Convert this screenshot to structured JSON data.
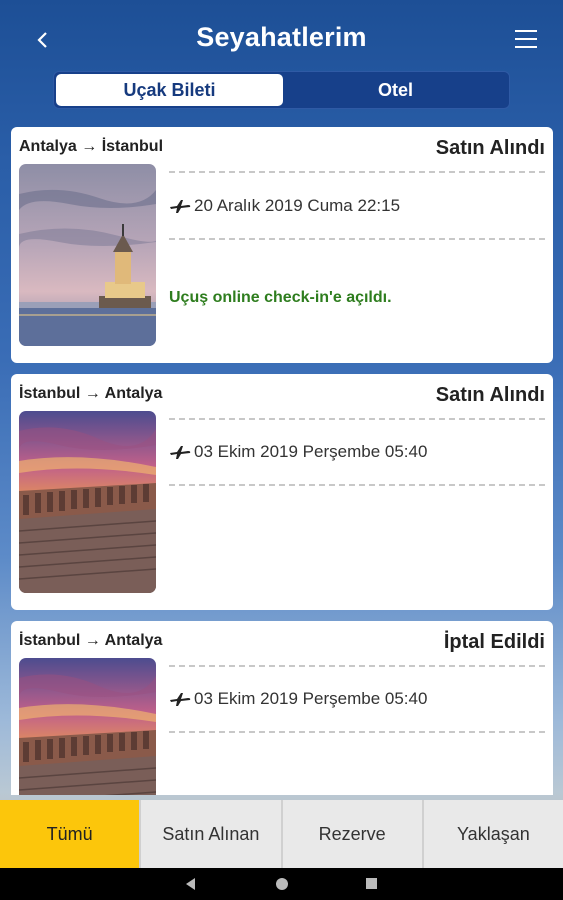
{
  "header": {
    "title": "Seyahatlerim",
    "back_icon": "chevron-left-icon",
    "menu_icon": "hamburger-menu-icon"
  },
  "tabs": [
    {
      "label": "Uçak Bileti",
      "active": true
    },
    {
      "label": "Otel",
      "active": false
    }
  ],
  "trips": [
    {
      "route": "Antalya → İstanbul",
      "status": "Satın Alındı",
      "date": "20 Aralık 2019 Cuma 22:15",
      "notice": "Uçuş online check-in'e açıldı.",
      "image": "maiden-tower-photo"
    },
    {
      "route": "İstanbul → Antalya",
      "status": "Satın Alındı",
      "date": "03 Ekim 2019 Perşembe 05:40",
      "notice": "",
      "image": "aspendos-theatre-photo"
    },
    {
      "route": "İstanbul → Antalya",
      "status": "İptal Edildi",
      "date": "03 Ekim 2019 Perşembe 05:40",
      "notice": "",
      "image": "aspendos-theatre-photo"
    }
  ],
  "bottom_tabs": [
    {
      "label": "Tümü",
      "active": true
    },
    {
      "label": "Satın Alınan",
      "active": false
    },
    {
      "label": "Rezerve",
      "active": false
    },
    {
      "label": "Yaklaşan",
      "active": false
    }
  ],
  "colors": {
    "accent_yellow": "#fcc60b",
    "tab_blue": "#17408a",
    "notice_green": "#2e7d1e"
  }
}
